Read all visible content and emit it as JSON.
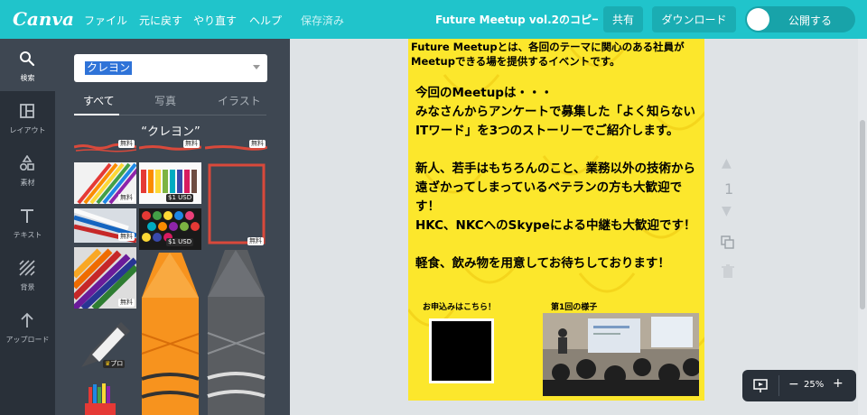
{
  "app": {
    "logo": "Canva",
    "menu": [
      "ファイル",
      "元に戻す",
      "やり直す",
      "ヘルプ"
    ],
    "saved": "保存済み",
    "doc_title": "Future Meetup vol.2のコピー...",
    "share": "共有",
    "download": "ダウンロード",
    "publish": "公開する"
  },
  "rail": [
    "検索",
    "レイアウト",
    "素材",
    "テキスト",
    "背景",
    "アップロード"
  ],
  "panel": {
    "search_value": "クレヨン",
    "tabs": [
      "すべて",
      "写真",
      "イラスト"
    ],
    "heading": "“クレヨン”",
    "badges": {
      "free": "無料",
      "price": "$1 USD",
      "pro": "プロ"
    }
  },
  "page": {
    "intro": "Future Meetupとは、各回のテーマに関心のある社員がMeetupできる場を提供するイベントです。",
    "body_lines": [
      "今回のMeetupは・・・",
      "みなさんからアンケートで募集した「よく知らないITワード」を3つのストーリーでご紹介します。",
      "",
      "新人、若手はもちろんのこと、業務以外の技術から遠ざかってしまっているベテランの方も大歓迎です！",
      "HKC、NKCへのSkypeによる中継も大歓迎です！",
      "",
      "軽食、飲み物を用意してお待ちしております！"
    ],
    "label_signup": "お申込みはこちら！",
    "label_first": "第1回の様子"
  },
  "workspace": {
    "page_number": "1",
    "zoom": "25%"
  }
}
